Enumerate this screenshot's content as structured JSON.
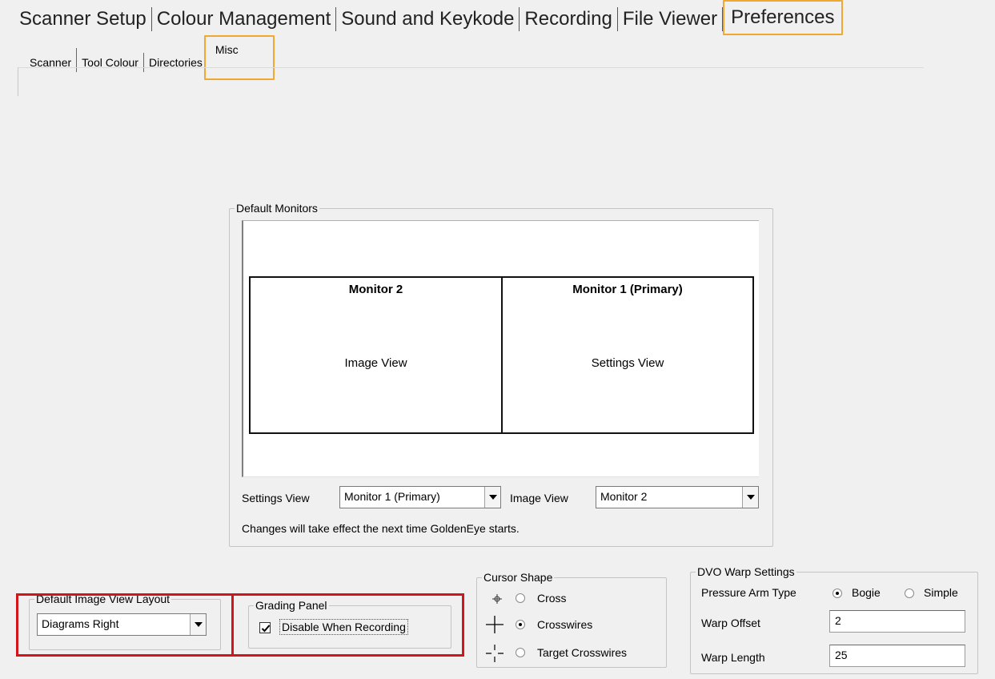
{
  "main_tabs": [
    "Scanner Setup",
    "Colour Management",
    "Sound and Keykode",
    "Recording",
    "File Viewer",
    "Preferences"
  ],
  "sub_tabs": [
    "Scanner",
    "Tool Colour",
    "Directories",
    "Misc"
  ],
  "default_monitors": {
    "legend": "Default Monitors",
    "left_monitor": {
      "title": "Monitor 2",
      "view": "Image View"
    },
    "right_monitor": {
      "title": "Monitor 1 (Primary)",
      "view": "Settings View"
    },
    "settings_view_label": "Settings View",
    "settings_view_value": "Monitor 1 (Primary)",
    "image_view_label": "Image View",
    "image_view_value": "Monitor 2",
    "note": "Changes will take effect the next time GoldenEye starts."
  },
  "image_view_layout": {
    "legend": "Default Image View Layout",
    "value": "Diagrams Right"
  },
  "grading_panel": {
    "legend": "Grading Panel",
    "checkbox_label": "Disable When Recording",
    "checked": true
  },
  "cursor_shape": {
    "legend": "Cursor Shape",
    "options": [
      {
        "label": "Cross",
        "selected": false,
        "icon": "cross-cursor-icon"
      },
      {
        "label": "Crosswires",
        "selected": true,
        "icon": "crosswires-cursor-icon"
      },
      {
        "label": "Target Crosswires",
        "selected": false,
        "icon": "target-crosswires-cursor-icon"
      }
    ]
  },
  "dvo_warp": {
    "legend": "DVO Warp Settings",
    "pressure_arm_label": "Pressure Arm Type",
    "pressure_arm_options": [
      {
        "label": "Bogie",
        "selected": true
      },
      {
        "label": "Simple",
        "selected": false
      }
    ],
    "warp_offset_label": "Warp Offset",
    "warp_offset_value": "2",
    "warp_length_label": "Warp Length",
    "warp_length_value": "25"
  },
  "colors": {
    "highlight_orange": "#f0a830",
    "highlight_red": "#d0151b"
  }
}
